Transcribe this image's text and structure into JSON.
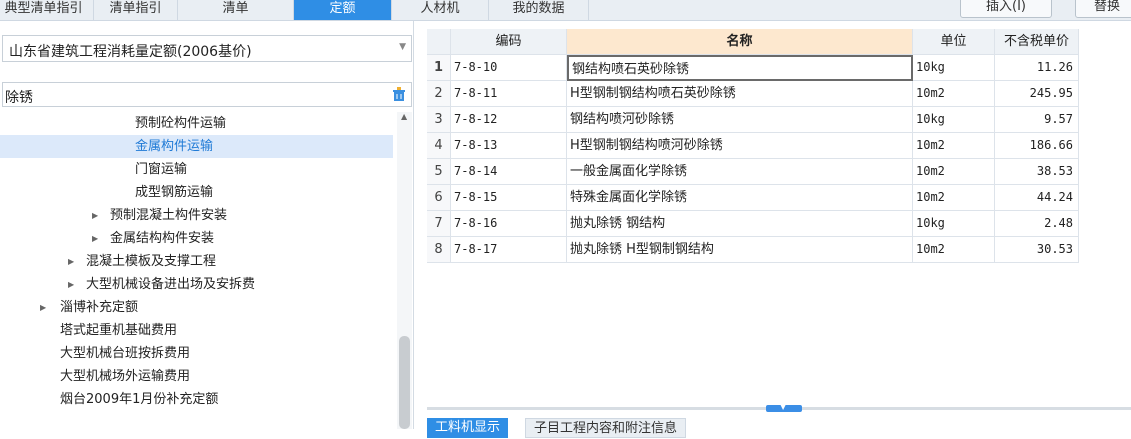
{
  "top_tabs": [
    "典型清单指引",
    "清单指引",
    "清单",
    "定额",
    "人材机",
    "我的数据"
  ],
  "active_tab_index": 3,
  "actions": {
    "insert_label": "插入(I)",
    "replace_label": "替换"
  },
  "left": {
    "library_select": "山东省建筑工程消耗量定额(2006基价)",
    "search_value": "除锈",
    "tree": [
      {
        "label": "预制砼构件运输",
        "selected": false,
        "expandable": false
      },
      {
        "label": "金属构件运输",
        "selected": true,
        "expandable": false
      },
      {
        "label": "门窗运输",
        "selected": false,
        "expandable": false
      },
      {
        "label": "成型钢筋运输",
        "selected": false,
        "expandable": false
      },
      {
        "label": "预制混凝土构件安装",
        "selected": false,
        "expandable": true
      },
      {
        "label": "金属结构构件安装",
        "selected": false,
        "expandable": true
      },
      {
        "label": "混凝土模板及支撑工程",
        "selected": false,
        "expandable": true
      },
      {
        "label": "大型机械设备进出场及安拆费",
        "selected": false,
        "expandable": true
      },
      {
        "label": "淄博补充定额",
        "selected": false,
        "expandable": true
      },
      {
        "label": "塔式起重机基础费用",
        "selected": false,
        "expandable": false
      },
      {
        "label": "大型机械台班按拆费用",
        "selected": false,
        "expandable": false
      },
      {
        "label": "大型机械场外运输费用",
        "selected": false,
        "expandable": false
      },
      {
        "label": "烟台2009年1月份补充定额",
        "selected": false,
        "expandable": false
      }
    ]
  },
  "table": {
    "headers": {
      "code": "编码",
      "name": "名称",
      "unit": "单位",
      "price": "不含税单价"
    },
    "rows": [
      {
        "idx": "1",
        "code": "7-8-10",
        "name": "钢结构喷石英砂除锈",
        "unit": "10kg",
        "price": "11.26"
      },
      {
        "idx": "2",
        "code": "7-8-11",
        "name": "H型钢制钢结构喷石英砂除锈",
        "unit": "10m2",
        "price": "245.95"
      },
      {
        "idx": "3",
        "code": "7-8-12",
        "name": "钢结构喷河砂除锈",
        "unit": "10kg",
        "price": "9.57"
      },
      {
        "idx": "4",
        "code": "7-8-13",
        "name": "H型钢制钢结构喷河砂除锈",
        "unit": "10m2",
        "price": "186.66"
      },
      {
        "idx": "5",
        "code": "7-8-14",
        "name": "一般金属面化学除锈",
        "unit": "10m2",
        "price": "38.53"
      },
      {
        "idx": "6",
        "code": "7-8-15",
        "name": "特殊金属面化学除锈",
        "unit": "10m2",
        "price": "44.24"
      },
      {
        "idx": "7",
        "code": "7-8-16",
        "name": "抛丸除锈 钢结构",
        "unit": "10kg",
        "price": "2.48"
      },
      {
        "idx": "8",
        "code": "7-8-17",
        "name": "抛丸除锈 H型钢制钢结构",
        "unit": "10m2",
        "price": "30.53"
      }
    ]
  },
  "bottom_tabs": [
    "工料机显示",
    "子目工程内容和附注信息"
  ],
  "colors": {
    "accent": "#2f8ee5",
    "selected_row": "#dce9fa",
    "name_header": "#fde8cf"
  }
}
